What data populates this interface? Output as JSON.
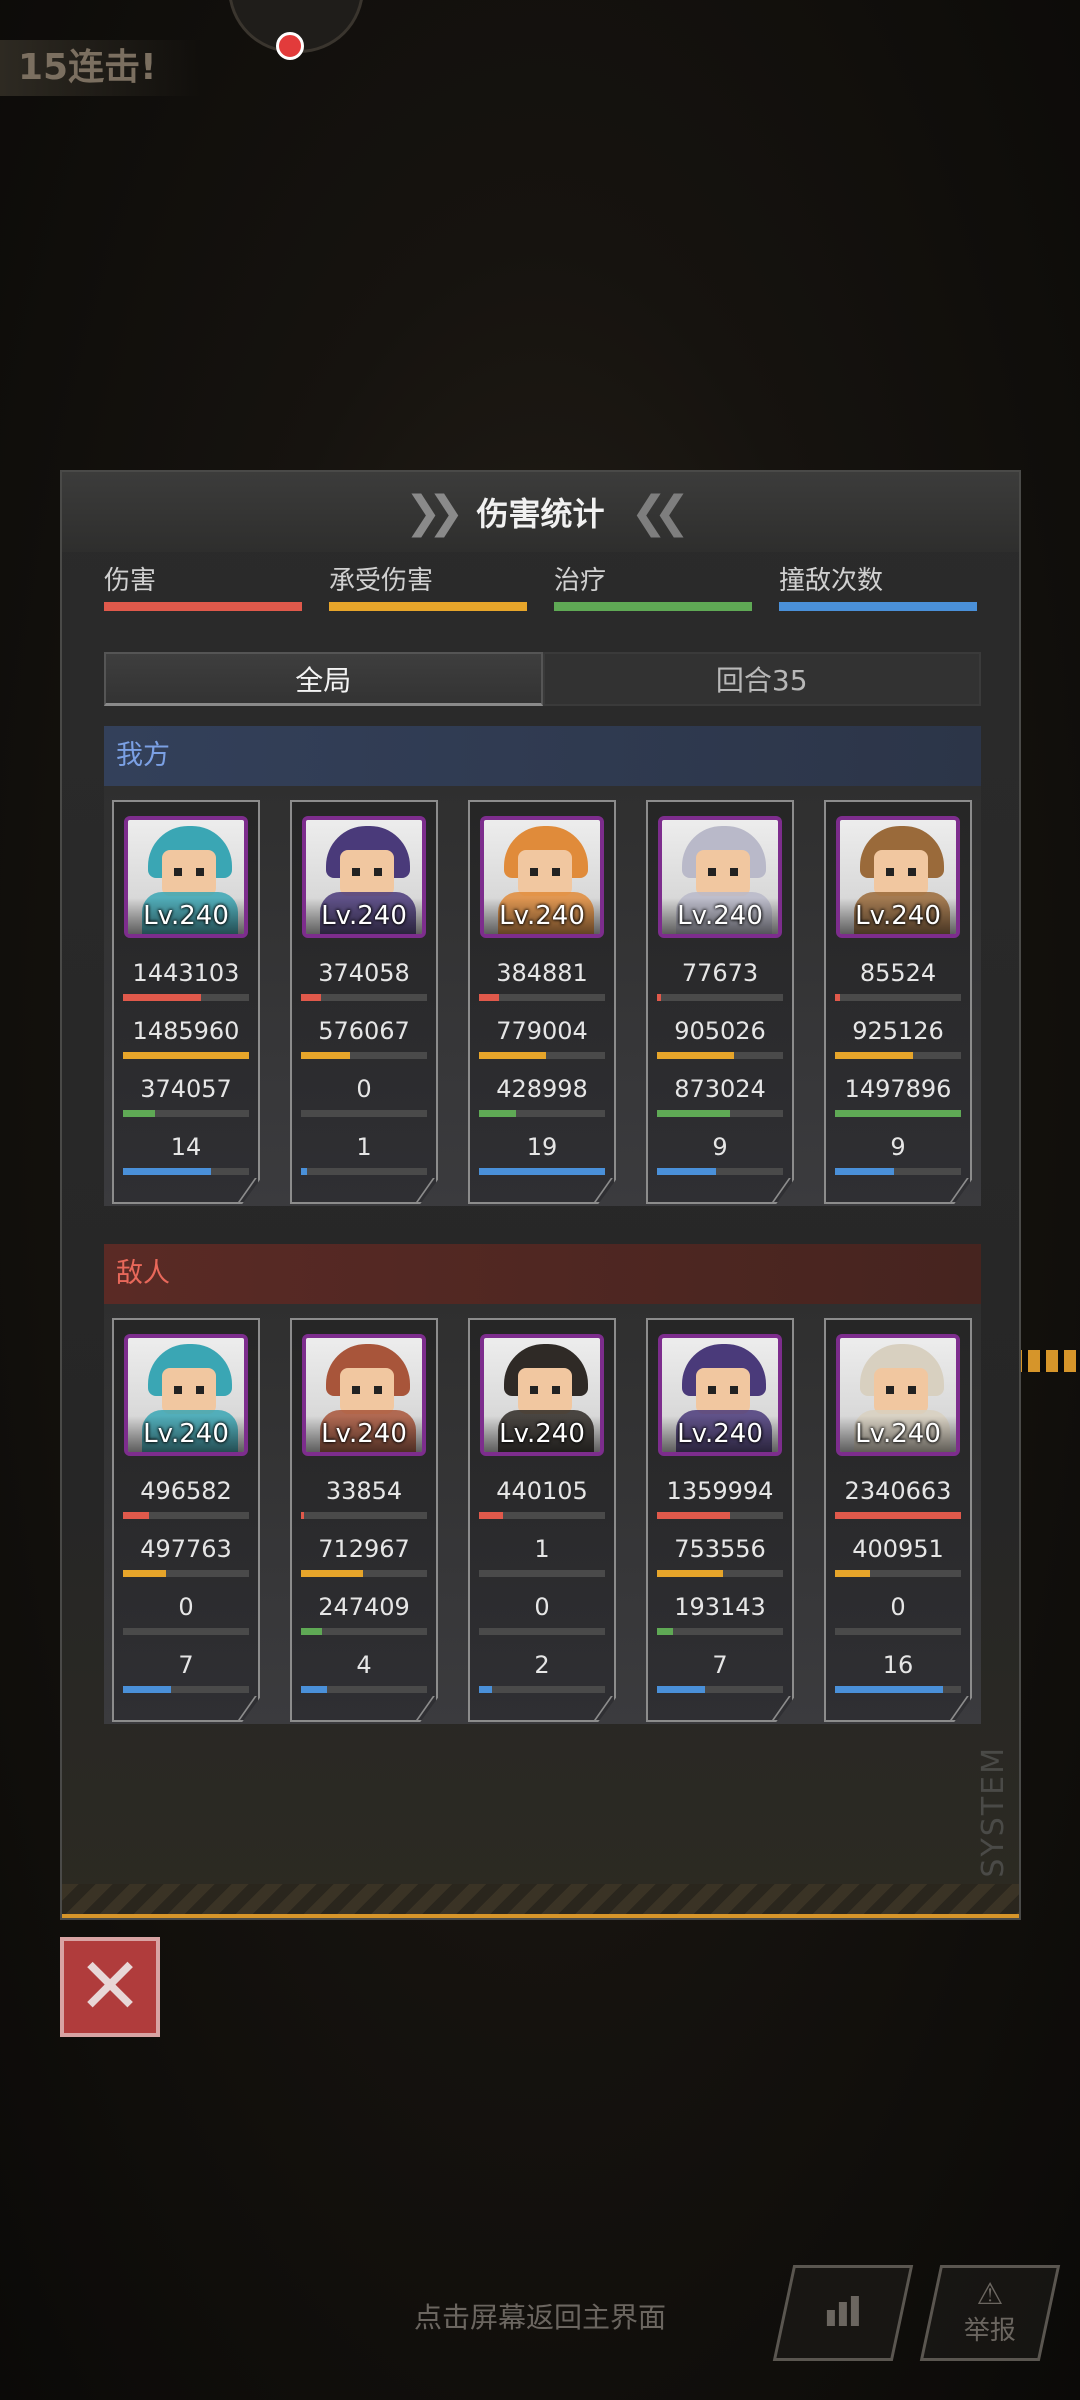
{
  "background": {
    "combo_text": "15连击!"
  },
  "panel": {
    "title": "伤害统计"
  },
  "legend": [
    {
      "label": "伤害",
      "color": "#e0594b"
    },
    {
      "label": "承受伤害",
      "color": "#e7a52a"
    },
    {
      "label": "治疗",
      "color": "#5fa955"
    },
    {
      "label": "撞敌次数",
      "color": "#4a90d9"
    }
  ],
  "tabs": [
    {
      "label": "全局",
      "active": true
    },
    {
      "label": "回合35",
      "active": false
    }
  ],
  "ally": {
    "title": "我方",
    "units": [
      {
        "level": "Lv.240",
        "damage": "1443103",
        "taken": "1485960",
        "heal": "374057",
        "hits": "14",
        "fill": [
          0.62,
          1.0,
          0.25,
          0.7
        ],
        "theme": "#3aa6b4"
      },
      {
        "level": "Lv.240",
        "damage": "374058",
        "taken": "576067",
        "heal": "0",
        "hits": "1",
        "fill": [
          0.16,
          0.39,
          0.0,
          0.05
        ],
        "theme": "#4a3a7a"
      },
      {
        "level": "Lv.240",
        "damage": "384881",
        "taken": "779004",
        "heal": "428998",
        "hits": "19",
        "fill": [
          0.16,
          0.53,
          0.29,
          1.0
        ],
        "theme": "#e08b3a"
      },
      {
        "level": "Lv.240",
        "damage": "77673",
        "taken": "905026",
        "heal": "873024",
        "hits": "9",
        "fill": [
          0.03,
          0.61,
          0.58,
          0.47
        ],
        "theme": "#b9b9c9"
      },
      {
        "level": "Lv.240",
        "damage": "85524",
        "taken": "925126",
        "heal": "1497896",
        "hits": "9",
        "fill": [
          0.04,
          0.62,
          1.0,
          0.47
        ],
        "theme": "#9a6a3a"
      }
    ]
  },
  "enemy": {
    "title": "敌人",
    "units": [
      {
        "level": "Lv.240",
        "damage": "496582",
        "taken": "497763",
        "heal": "0",
        "hits": "7",
        "fill": [
          0.21,
          0.34,
          0.0,
          0.38
        ],
        "theme": "#3aa6b4"
      },
      {
        "level": "Lv.240",
        "damage": "33854",
        "taken": "712967",
        "heal": "247409",
        "hits": "4",
        "fill": [
          0.02,
          0.49,
          0.17,
          0.21
        ],
        "theme": "#a8553a"
      },
      {
        "level": "Lv.240",
        "damage": "440105",
        "taken": "1",
        "heal": "0",
        "hits": "2",
        "fill": [
          0.19,
          0.0,
          0.0,
          0.1
        ],
        "theme": "#2f2a26"
      },
      {
        "level": "Lv.240",
        "damage": "1359994",
        "taken": "753556",
        "heal": "193143",
        "hits": "7",
        "fill": [
          0.58,
          0.52,
          0.13,
          0.38
        ],
        "theme": "#4a3a7a"
      },
      {
        "level": "Lv.240",
        "damage": "2340663",
        "taken": "400951",
        "heal": "0",
        "hits": "16",
        "fill": [
          1.0,
          0.28,
          0.0,
          0.86
        ],
        "theme": "#d8d0c0"
      }
    ]
  },
  "watermark": "SYSTEM",
  "footer": {
    "hint": "点击屏幕返回主界面",
    "report_label": "举报"
  },
  "icons": {
    "close": "close-icon",
    "chart": "bar-chart-icon",
    "report": "warning-icon"
  }
}
